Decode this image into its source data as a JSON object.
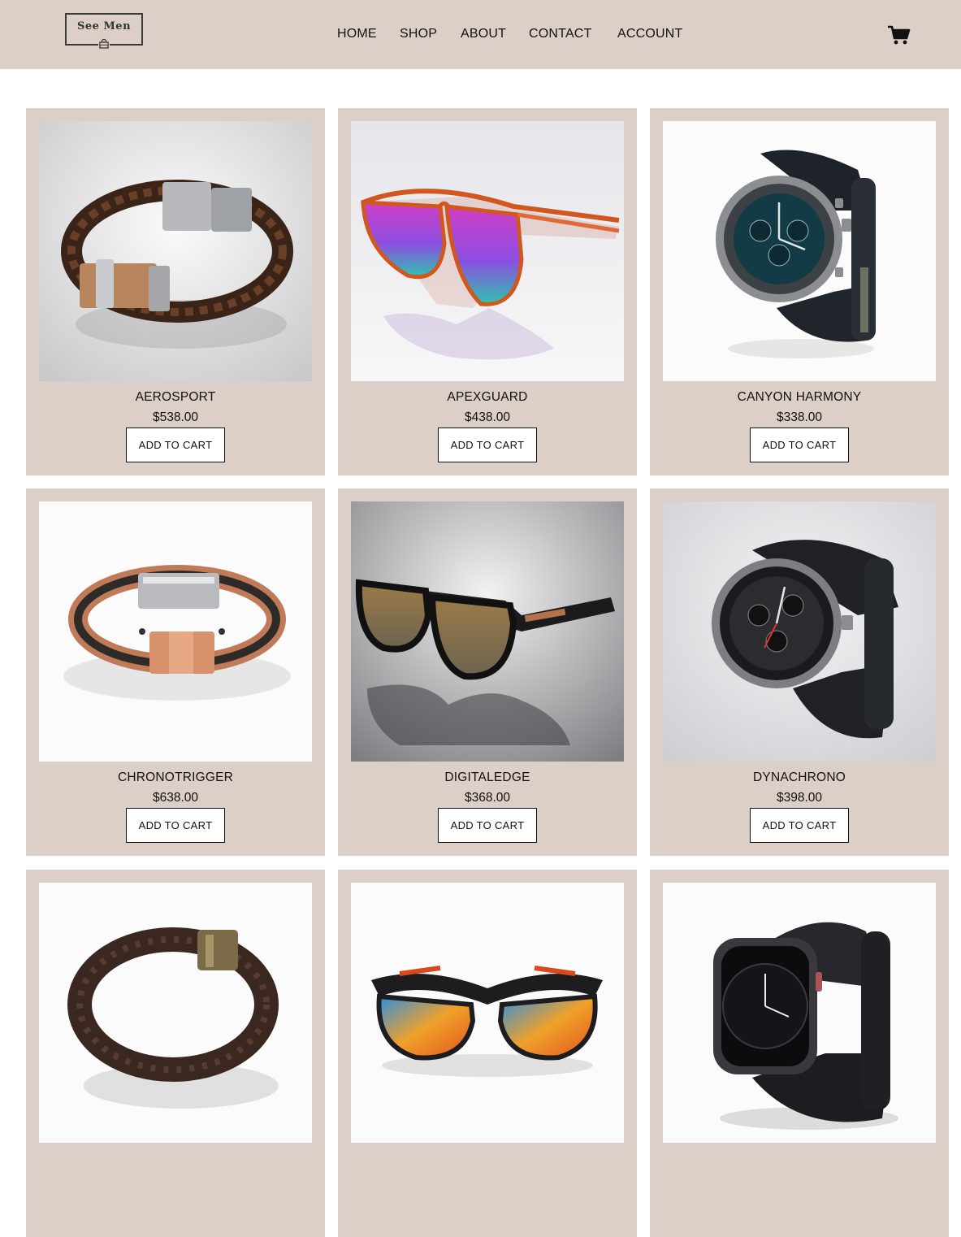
{
  "brand": {
    "name": "See Men",
    "logo_icon": "shopping-bag-icon"
  },
  "nav": {
    "items": [
      "HOME",
      "SHOP",
      "ABOUT",
      "CONTACT",
      "ACCOUNT"
    ]
  },
  "header_icons": {
    "cart": "shopping-cart-icon"
  },
  "colors": {
    "accent": "#dccfc7",
    "text": "#111111",
    "background": "#ffffff"
  },
  "products": [
    {
      "name": "AEROSPORT",
      "price": "$538.00",
      "button": "ADD TO CART",
      "image": "braided-leather-bracelet"
    },
    {
      "name": "APEXGUARD",
      "price": "$438.00",
      "button": "ADD TO CART",
      "image": "iridescent-sunglasses"
    },
    {
      "name": "CANYON HARMONY",
      "price": "$338.00",
      "button": "ADD TO CART",
      "image": "chronograph-watch-teal"
    },
    {
      "name": "CHRONOTRIGGER",
      "price": "$638.00",
      "button": "ADD TO CART",
      "image": "rose-gold-bracelet"
    },
    {
      "name": "DIGITALEDGE",
      "price": "$368.00",
      "button": "ADD TO CART",
      "image": "bronze-lens-sunglasses"
    },
    {
      "name": "DYNACHRONO",
      "price": "$398.00",
      "button": "ADD TO CART",
      "image": "black-chronograph-watch"
    },
    {
      "name": "",
      "price": "",
      "button": "",
      "image": "brown-leather-bracelet"
    },
    {
      "name": "",
      "price": "",
      "button": "",
      "image": "sport-wrap-sunglasses"
    },
    {
      "name": "",
      "price": "",
      "button": "",
      "image": "black-smartwatch"
    }
  ]
}
